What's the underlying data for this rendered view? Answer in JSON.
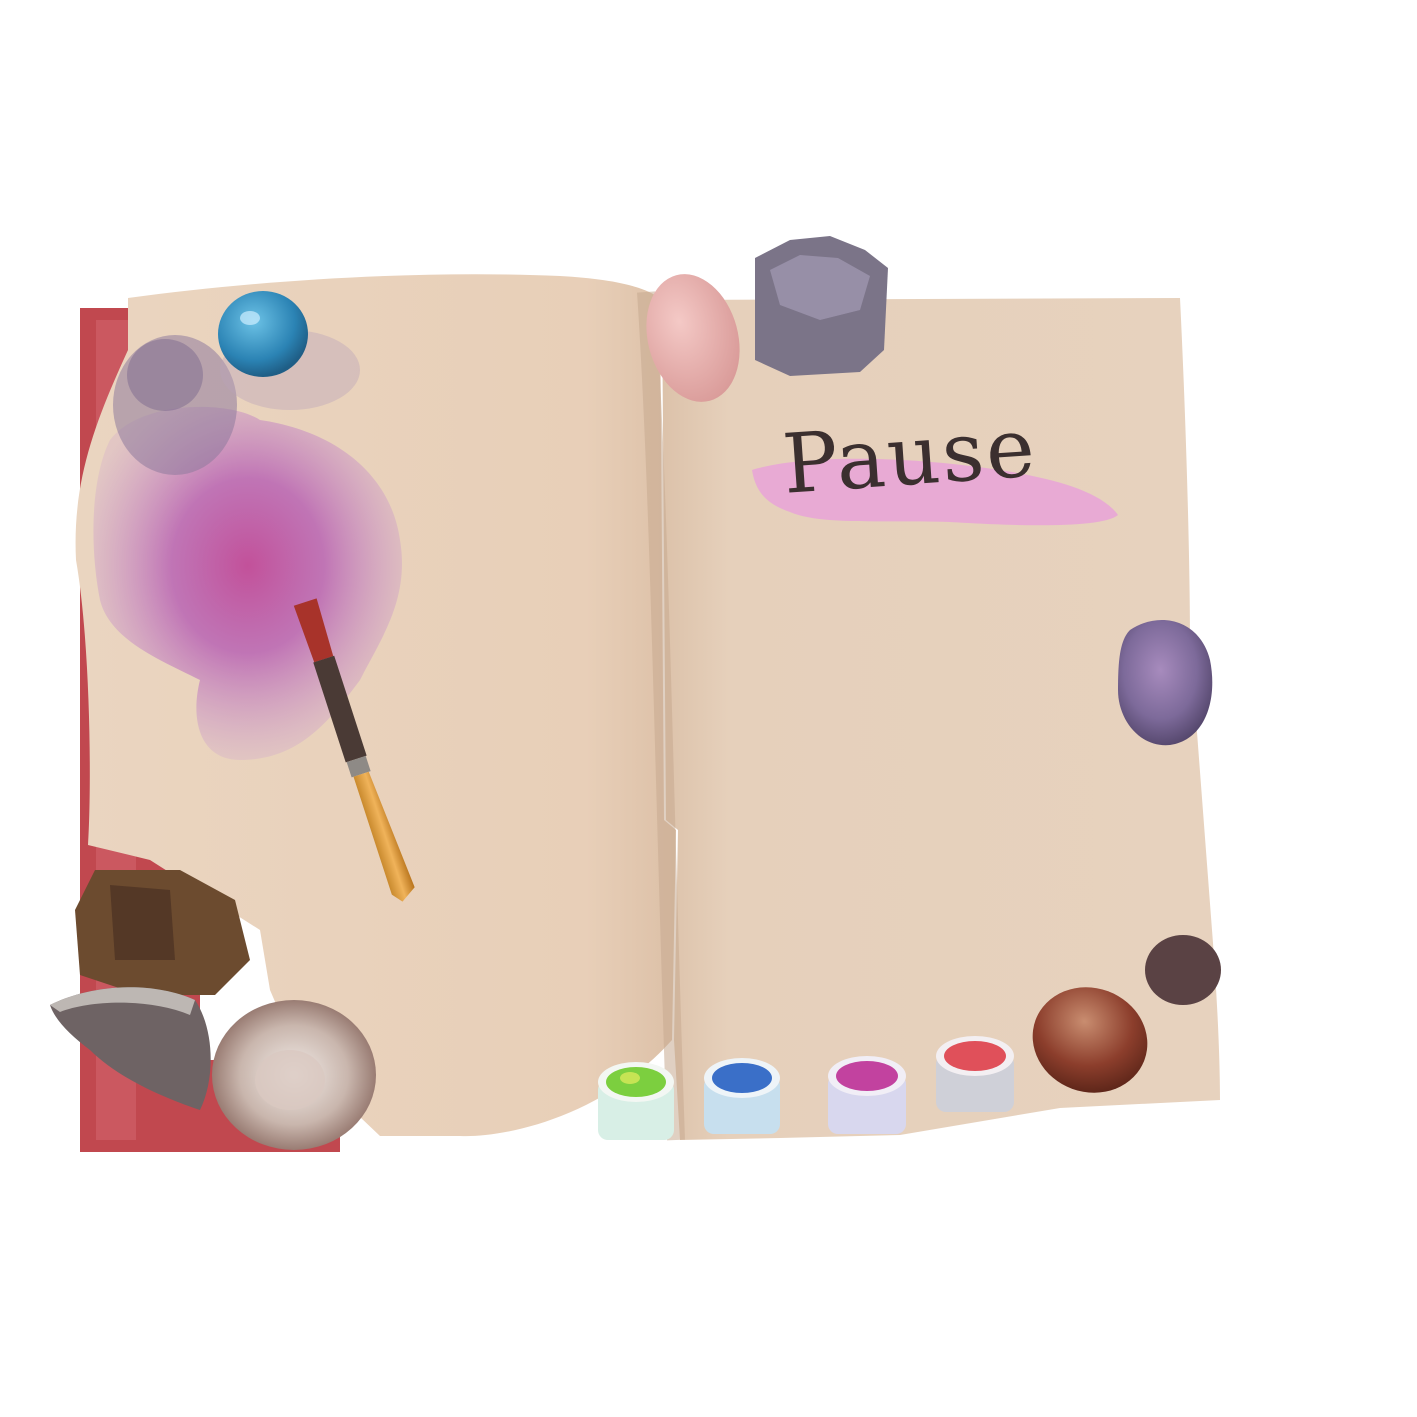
{
  "page": {
    "title": "Pause"
  },
  "palette": {
    "paper": "#e9d3bd",
    "cover": "#c1484f",
    "highlight": "#e8a3d8",
    "ink_splash": "#b64ea8",
    "title_color": "#3b2f2f"
  },
  "objects": {
    "stones": [
      "blue-stone",
      "lavender-stone",
      "rose-quartz",
      "amethyst-cluster",
      "agate-right",
      "dark-pebble",
      "jasper-stone",
      "amber-agate",
      "geode-slice",
      "agate-geode"
    ],
    "brush": "paintbrush",
    "paint_pots": [
      {
        "name": "green-paint-pot",
        "color": "#7ccf3f"
      },
      {
        "name": "blue-paint-pot",
        "color": "#3a6fc8"
      },
      {
        "name": "magenta-paint-pot",
        "color": "#c2429f"
      },
      {
        "name": "red-paint-pot",
        "color": "#e0505a"
      }
    ]
  }
}
